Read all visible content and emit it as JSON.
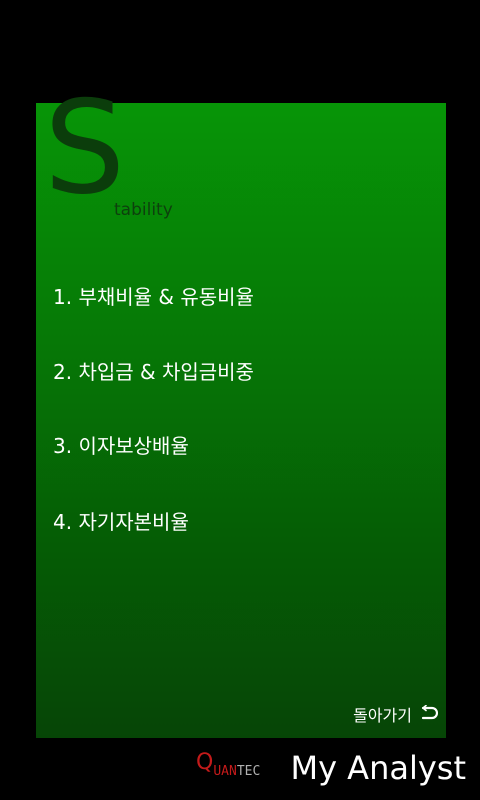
{
  "header": {
    "title_initial": "S",
    "title_rest": "tability"
  },
  "menu": {
    "items": [
      {
        "label": "1. 부채비율 & 유동비율"
      },
      {
        "label": "2. 차입금 & 차입금비중"
      },
      {
        "label": "3. 이자보상배율"
      },
      {
        "label": "4. 자기자본비율"
      }
    ]
  },
  "back": {
    "label": "돌아가기",
    "icon": "return-arrow-icon"
  },
  "footer": {
    "logo": {
      "q": "Q",
      "uan": "UAN",
      "tec": "TEC"
    },
    "app_name": "My Analyst"
  },
  "colors": {
    "background": "#000000",
    "panel_top": "#079507",
    "panel_bottom": "#064506",
    "title": "#0b3d0b",
    "text": "#ffffff",
    "logo_red": "#c41a1a"
  }
}
